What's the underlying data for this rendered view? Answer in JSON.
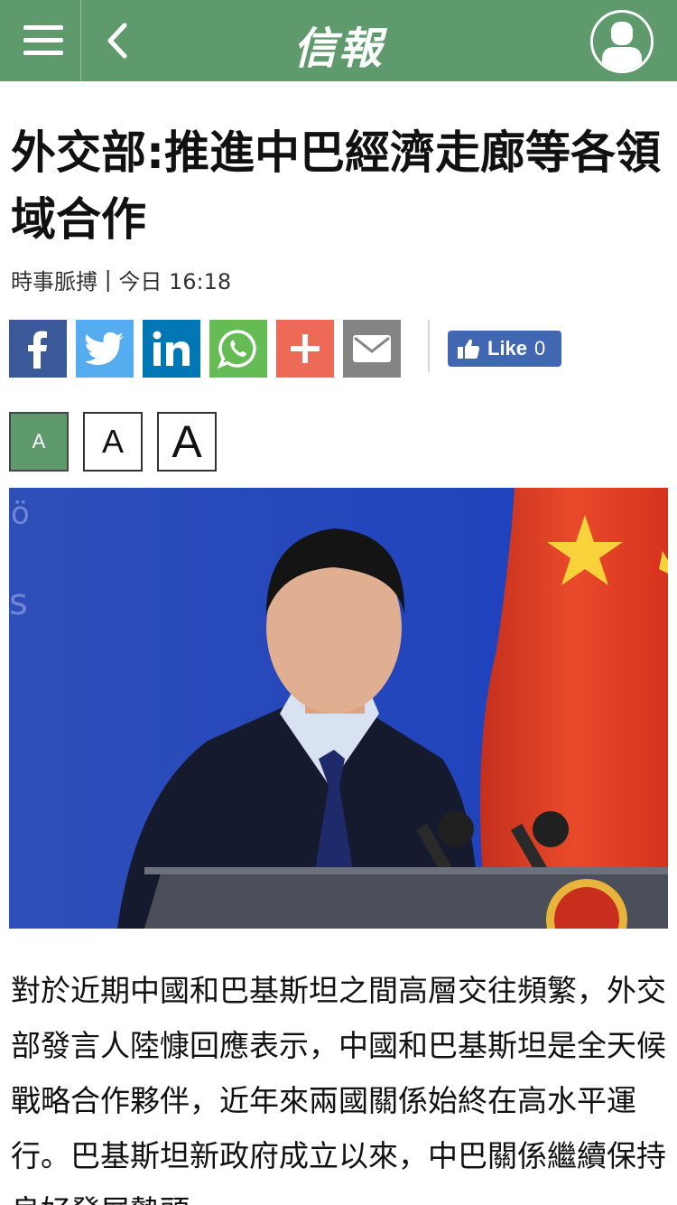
{
  "header": {
    "logo_text": "信報",
    "menu_icon": "hamburger-menu-icon",
    "back_icon": "chevron-left-icon",
    "user_icon": "user-profile-icon",
    "bg_color": "#5f9a6d"
  },
  "article": {
    "title": "外交部:推進中巴經濟走廊等各領域合作",
    "category": "時事脈搏",
    "separator": "|",
    "time": "今日 16:18",
    "photo_alt": "外交部發言人陸慷",
    "body": "對於近期中國和巴基斯坦之間高層交往頻繁，外交部發言人陸慷回應表示，中國和巴基斯坦是全天候戰略合作夥伴，近年來兩國關係始終在高水平運行。巴基斯坦新政府成立以來，中巴關係繼續保持良好發展勢頭"
  },
  "share": {
    "buttons": [
      {
        "name": "facebook",
        "color": "#3b5998"
      },
      {
        "name": "twitter",
        "color": "#55acee"
      },
      {
        "name": "linkedin",
        "color": "#0077b5"
      },
      {
        "name": "whatsapp",
        "color": "#65bc54"
      },
      {
        "name": "more",
        "color": "#ec6a56"
      },
      {
        "name": "email",
        "color": "#848484"
      }
    ],
    "like_label": "Like",
    "like_count": "0"
  },
  "font_size": {
    "buttons": [
      {
        "label": "A",
        "state": "active"
      },
      {
        "label": "A",
        "state": "inactive"
      },
      {
        "label": "A",
        "state": "inactive"
      }
    ]
  }
}
